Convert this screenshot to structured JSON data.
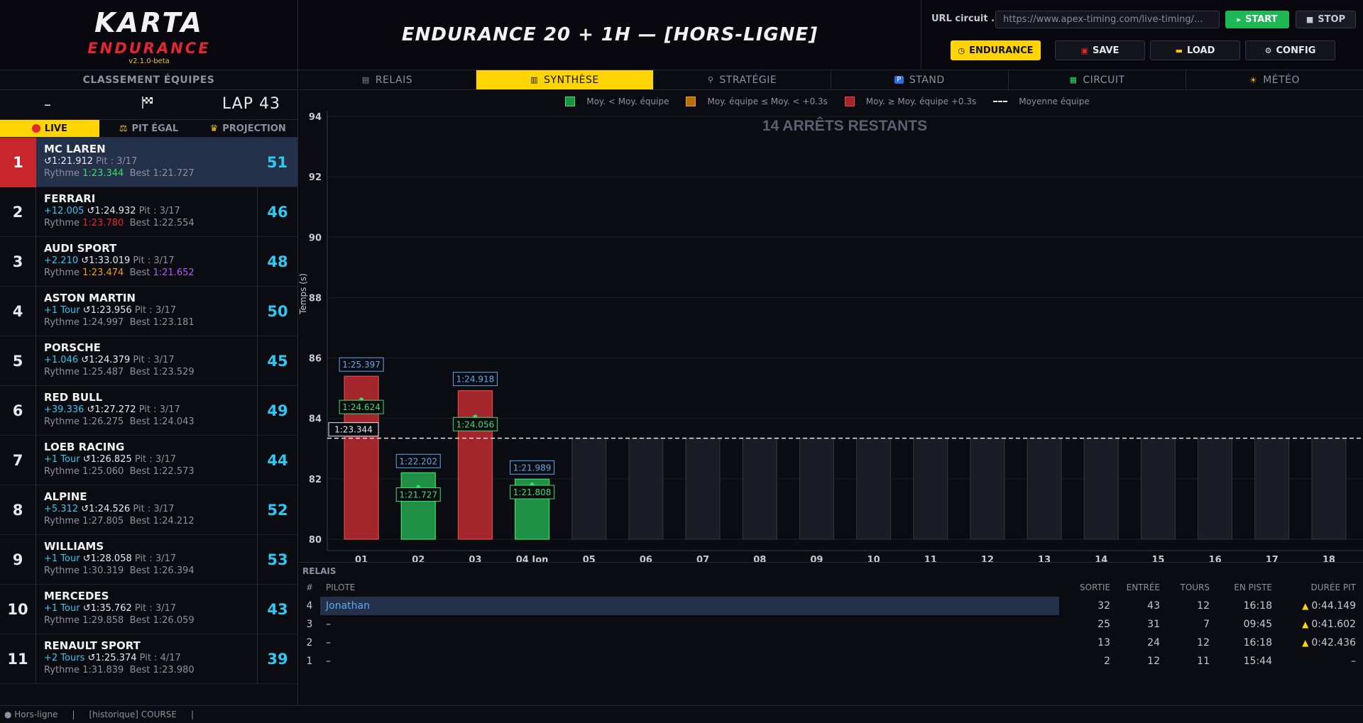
{
  "logo": {
    "line1": "KARTA",
    "line2": "ENDURANCE",
    "version": "v2.1.0-beta"
  },
  "race_title": "ENDURANCE 20 + 1H  —  [HORS-LIGNE]",
  "controls": {
    "url_label": "URL circuit .",
    "url_value": "https://www.apex-timing.com/live-timing/...",
    "start": "START",
    "stop": "STOP",
    "modes": {
      "endurance": "ENDURANCE",
      "save": "SAVE",
      "load": "LOAD",
      "config": "CONFIG"
    }
  },
  "standings": {
    "title": "CLASSEMENT ÉQUIPES",
    "dash": "–",
    "lap": "LAP 43",
    "views": {
      "live": "LIVE",
      "pit_egal": "PIT ÉGAL",
      "projection": "PROJECTION"
    },
    "rythme_label": "Rythme",
    "best_label": "Best",
    "pit_label": "Pit :",
    "teams": [
      {
        "pos": "1",
        "name": "MC LAREN",
        "gap": "",
        "last": "↺1:21.912",
        "pit": "3/17",
        "rythme": "1:23.344",
        "best": "1:21.727",
        "kart": "51"
      },
      {
        "pos": "2",
        "name": "FERRARI",
        "gap": "+12.005",
        "last": "↺1:24.932",
        "pit": "3/17",
        "rythme": "1:23.780",
        "best": "1:22.554",
        "kart": "46"
      },
      {
        "pos": "3",
        "name": "AUDI SPORT",
        "gap": "+2.210",
        "last": "↺1:33.019",
        "pit": "3/17",
        "rythme": "1:23.474",
        "best": "1:21.652",
        "kart": "48"
      },
      {
        "pos": "4",
        "name": "ASTON MARTIN",
        "gap": "+1 Tour",
        "last": "↺1:23.956",
        "pit": "3/17",
        "rythme": "1:24.997",
        "best": "1:23.181",
        "kart": "50"
      },
      {
        "pos": "5",
        "name": "PORSCHE",
        "gap": "+1.046",
        "last": "↺1:24.379",
        "pit": "3/17",
        "rythme": "1:25.487",
        "best": "1:23.529",
        "kart": "45"
      },
      {
        "pos": "6",
        "name": "RED BULL",
        "gap": "+39.336",
        "last": "↺1:27.272",
        "pit": "3/17",
        "rythme": "1:26.275",
        "best": "1:24.043",
        "kart": "49"
      },
      {
        "pos": "7",
        "name": "LOEB RACING",
        "gap": "+1 Tour",
        "last": "↺1:26.825",
        "pit": "3/17",
        "rythme": "1:25.060",
        "best": "1:22.573",
        "kart": "44"
      },
      {
        "pos": "8",
        "name": "ALPINE",
        "gap": "+5.312",
        "last": "↺1:24.526",
        "pit": "3/17",
        "rythme": "1:27.805",
        "best": "1:24.212",
        "kart": "52"
      },
      {
        "pos": "9",
        "name": "WILLIAMS",
        "gap": "+1 Tour",
        "last": "↺1:28.058",
        "pit": "3/17",
        "rythme": "1:30.319",
        "best": "1:26.394",
        "kart": "53"
      },
      {
        "pos": "10",
        "name": "MERCEDES",
        "gap": "+1 Tour",
        "last": "↺1:35.762",
        "pit": "3/17",
        "rythme": "1:29.858",
        "best": "1:26.059",
        "kart": "43"
      },
      {
        "pos": "11",
        "name": "RENAULT SPORT",
        "gap": "+2 Tours",
        "last": "↺1:25.374",
        "pit": "4/17",
        "rythme": "1:31.839",
        "best": "1:23.980",
        "kart": "39"
      }
    ]
  },
  "tabs": [
    "RELAIS",
    "SYNTHÈSE",
    "STRATÉGIE",
    "STAND",
    "CIRCUIT",
    "MÉTÉO"
  ],
  "legend": {
    "green": "Moy. < Moy. équipe",
    "orange": "Moy. équipe ≤ Moy. < +0.3s",
    "red": "Moy. ≥ Moy. équipe +0.3s",
    "avg": "Moyenne équipe"
  },
  "colors": {
    "accent": "#ffd400",
    "green": "#1f8f45",
    "red": "#a3262d",
    "orange": "#b3700f",
    "cyan": "#2ec8f0",
    "blue_label": "#5fa8f0"
  },
  "chart_data": {
    "type": "bar",
    "title": "14 ARRÊTS RESTANTS",
    "ylabel": "Temps (s)",
    "ylim": [
      80,
      94
    ],
    "yticks": [
      80,
      82,
      84,
      86,
      88,
      90,
      92,
      94
    ],
    "team_average": 83.344,
    "team_average_label": "1:23.344",
    "categories": [
      "01",
      "02",
      "03",
      "04 Jon",
      "05",
      "06",
      "07",
      "08",
      "09",
      "10",
      "11",
      "12",
      "13",
      "14",
      "15",
      "16",
      "17",
      "18"
    ],
    "bars": [
      {
        "status": "red",
        "top": 85.397,
        "top_label": "1:25.397",
        "point": 84.624,
        "point_label": "1:24.624"
      },
      {
        "status": "green",
        "top": 82.202,
        "top_label": "1:22.202",
        "point": 81.727,
        "point_label": "1:21.727"
      },
      {
        "status": "red",
        "top": 84.918,
        "top_label": "1:24.918",
        "point": 84.056,
        "point_label": "1:24.056"
      },
      {
        "status": "green",
        "top": 81.989,
        "top_label": "1:21.989",
        "point": 81.808,
        "point_label": "1:21.808"
      },
      {
        "status": "pending"
      },
      {
        "status": "pending"
      },
      {
        "status": "pending"
      },
      {
        "status": "pending"
      },
      {
        "status": "pending"
      },
      {
        "status": "pending"
      },
      {
        "status": "pending"
      },
      {
        "status": "pending"
      },
      {
        "status": "pending"
      },
      {
        "status": "pending"
      },
      {
        "status": "pending"
      },
      {
        "status": "pending"
      },
      {
        "status": "pending"
      },
      {
        "status": "pending"
      }
    ]
  },
  "relais": {
    "title": "RELAIS",
    "headers": {
      "num": "#",
      "pilote": "PILOTE",
      "sortie": "SORTIE",
      "entree": "ENTRÉE",
      "tours": "TOURS",
      "en_piste": "EN PISTE",
      "duree_pit": "DURÉE PIT"
    },
    "rows": [
      {
        "num": "4",
        "pilote": "Jonathan",
        "sortie": "32",
        "entree": "43",
        "tours": "12",
        "en_piste": "16:18",
        "duree_pit": "0:44.149",
        "warn": true
      },
      {
        "num": "3",
        "pilote": "–",
        "sortie": "25",
        "entree": "31",
        "tours": "7",
        "en_piste": "09:45",
        "duree_pit": "0:41.602",
        "warn": true
      },
      {
        "num": "2",
        "pilote": "–",
        "sortie": "13",
        "entree": "24",
        "tours": "12",
        "en_piste": "16:18",
        "duree_pit": "0:42.436",
        "warn": true
      },
      {
        "num": "1",
        "pilote": "–",
        "sortie": "2",
        "entree": "12",
        "tours": "11",
        "en_piste": "15:44",
        "duree_pit": "–",
        "warn": false
      }
    ]
  },
  "status_bar": {
    "connection": "● Hors-ligne",
    "sep1": "|",
    "mode": "[historique] COURSE",
    "sep2": "|"
  }
}
